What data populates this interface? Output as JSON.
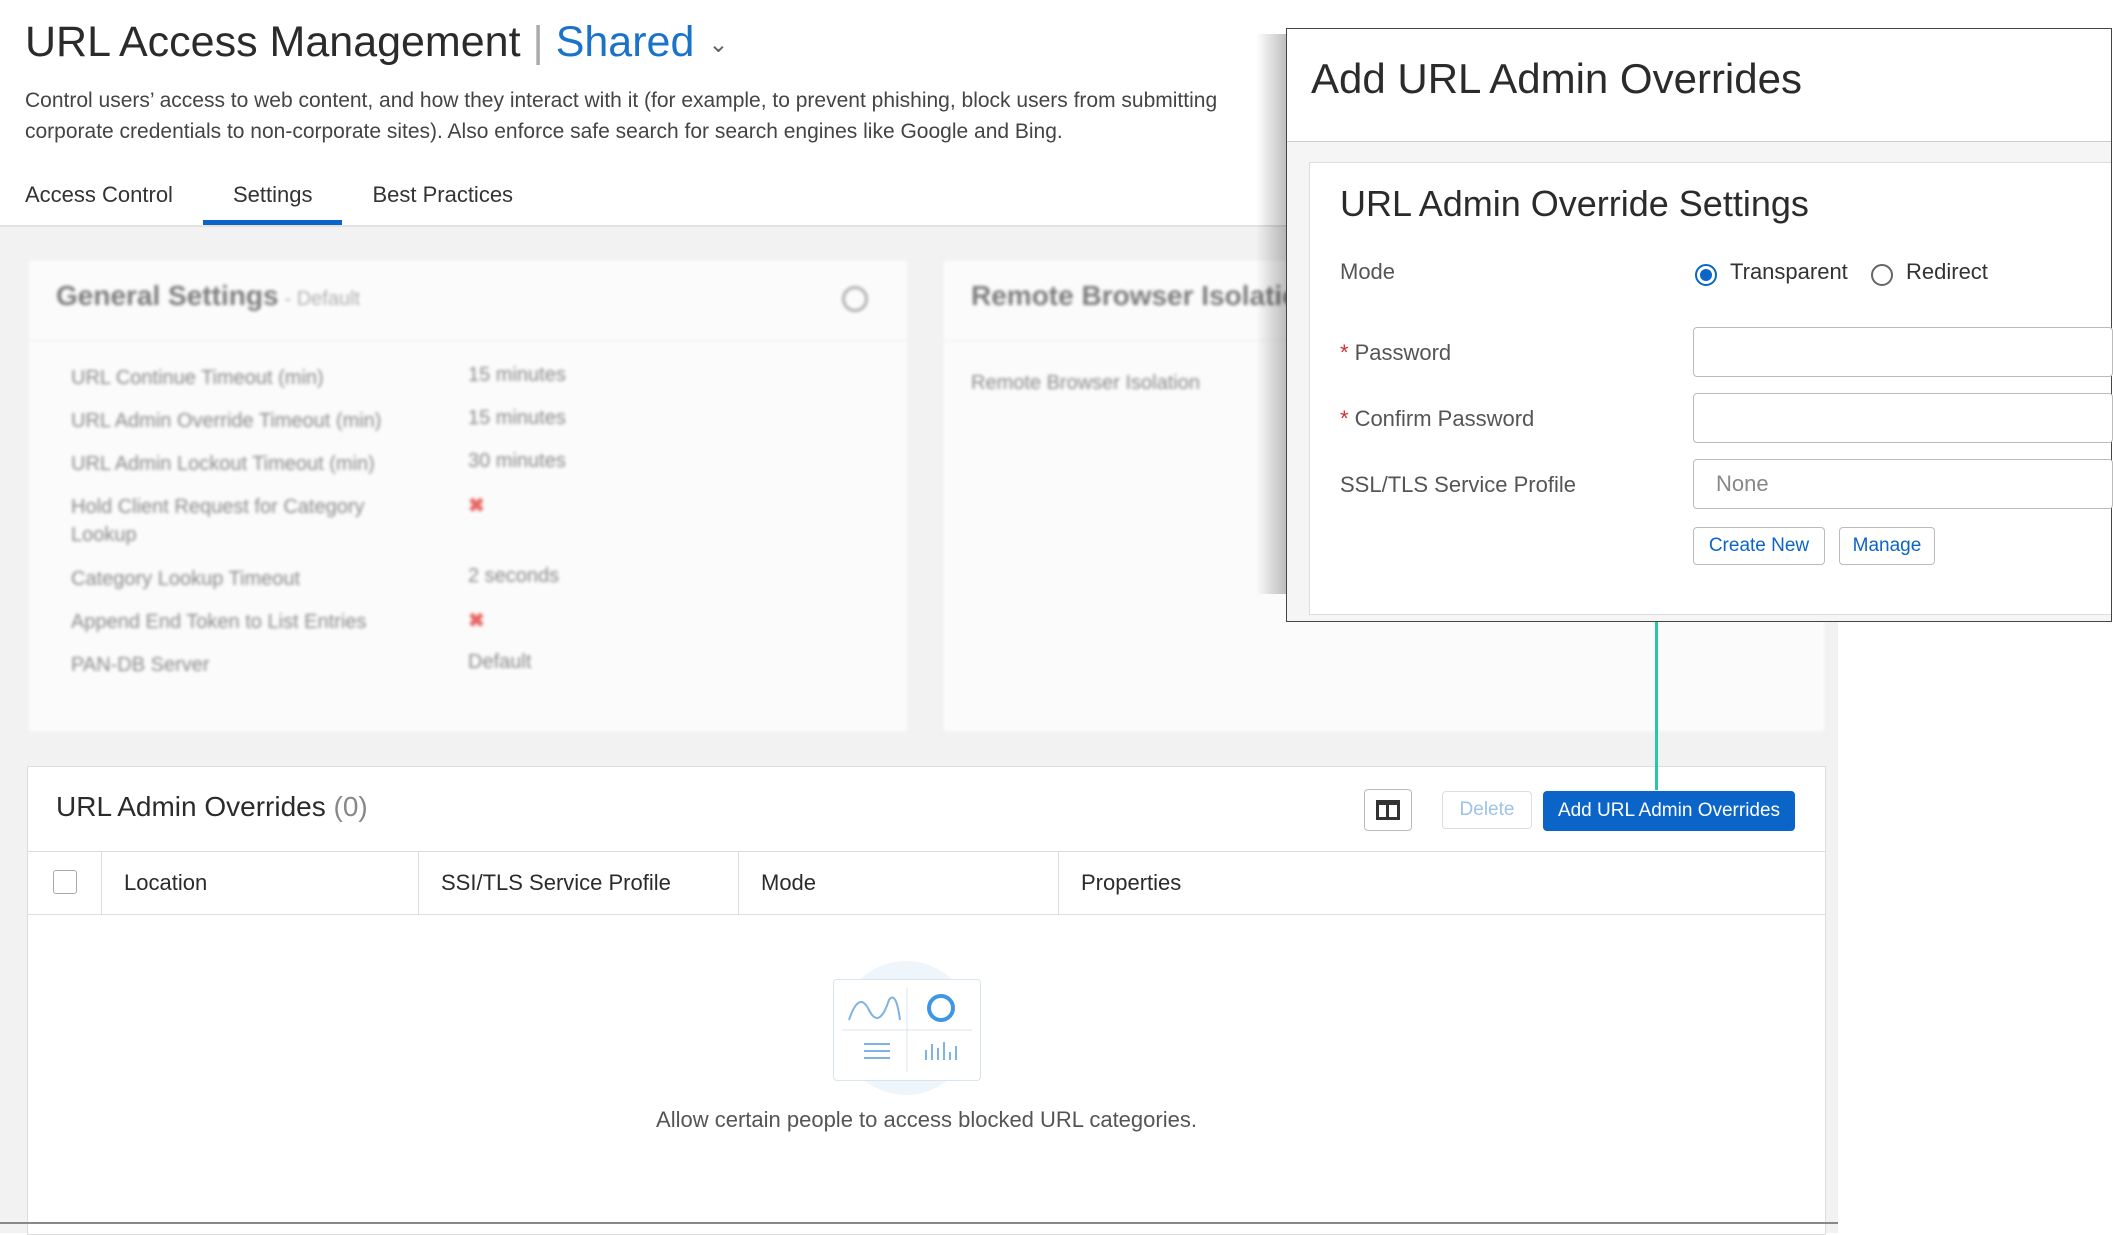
{
  "header": {
    "title": "URL Access Management",
    "separator": "|",
    "scope": "Shared",
    "description": "Control users’ access to web content, and how they interact with it (for example, to prevent phishing, block users from submitting corporate credentials to non-corporate sites). Also enforce safe search for search engines like Google and Bing."
  },
  "tabs": [
    {
      "label": "Access Control"
    },
    {
      "label": "Settings",
      "active": true
    },
    {
      "label": "Best Practices"
    }
  ],
  "general_settings": {
    "title": "General Settings",
    "subtitle": "- Default",
    "rows": [
      {
        "label": "URL Continue Timeout (min)",
        "value": "15 minutes"
      },
      {
        "label": "URL Admin Override Timeout (min)",
        "value": "15 minutes"
      },
      {
        "label": "URL Admin Lockout Timeout (min)",
        "value": "30 minutes"
      },
      {
        "label": "Hold Client Request for Category Lookup",
        "value": "✖"
      },
      {
        "label": "Category Lookup Timeout",
        "value": "2 seconds"
      },
      {
        "label": "Append End Token to List Entries",
        "value": "✖"
      },
      {
        "label": "PAN-DB Server",
        "value": "Default"
      }
    ]
  },
  "remote_browser_isolation": {
    "title": "Remote Browser Isolation",
    "row_label": "Remote Browser Isolation"
  },
  "overrides": {
    "title": "URL Admin Overrides",
    "count": "(0)",
    "delete_label": "Delete",
    "add_label": "Add URL Admin Overrides",
    "columns": [
      "Location",
      "SSI/TLS Service Profile",
      "Mode",
      "Properties"
    ],
    "empty_text": "Allow certain people to access blocked URL categories."
  },
  "dialog": {
    "title": "Add URL Admin Overrides",
    "panel_title": "URL Admin Override Settings",
    "mode_label": "Mode",
    "mode_options": [
      "Transparent",
      "Redirect"
    ],
    "mode_selected": "Transparent",
    "password_label": "Password",
    "confirm_password_label": "Confirm Password",
    "required_mark": "*",
    "ssl_label": "SSL/TLS Service Profile",
    "ssl_placeholder": "None",
    "create_new_label": "Create New",
    "manage_label": "Manage"
  },
  "colors": {
    "accent": "#0b64c8",
    "connector": "#26c9a5",
    "required": "#d32f2f"
  }
}
